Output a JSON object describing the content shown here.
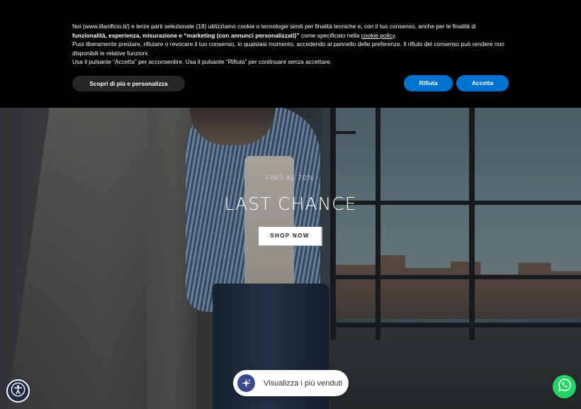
{
  "cookie_banner": {
    "line1_pre": "Noi (www.illanificio.it/) e terze parti selezionate (18) utilizziamo cookie o tecnologie simili per finalità tecniche e, con il tuo consenso, anche per le finalità di",
    "line2_bold": "funzionalità, esperienza, misurazione e “marketing (con annunci personalizzati)”",
    "line2_post": " come specificato nella ",
    "policy_link": "cookie policy",
    "line2_end": ".",
    "line3": "Puoi liberamente prestare, rifiutare o revocare il tuo consenso, in qualsiasi momento, accedendo al pannello delle preferenze. Il rifiuto del consenso può rendere non disponibili le relative funzioni.",
    "line4": "Usa il pulsante “Accetta” per acconsentire. Usa il pulsante “Rifiuta” per continuare senza accettare.",
    "more_button": "Scopri di più e personalizza",
    "reject_button": "Rifiuta",
    "accept_button": "Accetta"
  },
  "hero": {
    "eyebrow": "FINO AL 70%",
    "title": "LAST CHANCE",
    "cta": "SHOP NOW"
  },
  "floating": {
    "bestseller_label": "Visualizza i più venduti",
    "accessibility_icon": "accessibility-icon",
    "sparkle_icon": "sparkle-icon",
    "whatsapp_icon": "whatsapp-icon"
  },
  "colors": {
    "banner_bg": "#000000",
    "primary_blue": "#0073cf",
    "whatsapp_green": "#25d366",
    "accessibility_navy": "#1f2a44"
  }
}
